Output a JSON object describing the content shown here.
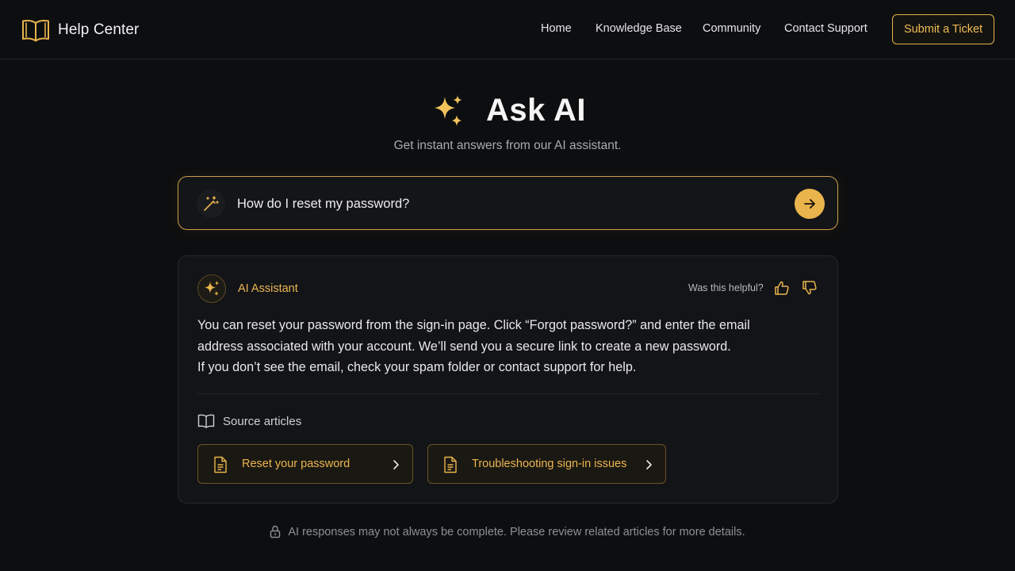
{
  "header": {
    "brand_title": "Help Center",
    "nav": [
      "Home",
      "Knowledge Base",
      "Community",
      "Contact Support"
    ],
    "cta_label": "Submit a Ticket"
  },
  "hero": {
    "title": "Ask AI",
    "subtitle": "Get instant answers from our AI assistant."
  },
  "search": {
    "value": "How do I reset my password?"
  },
  "answer": {
    "assistant_name": "AI Assistant",
    "helpful_label": "Was this helpful?",
    "lines": [
      "You can reset your password from the sign-in page. Click “Forgot password?” and enter the email",
      "address associated with your account. We’ll send you a secure link to create a new password.",
      "If you don’t see the email, check your spam folder or contact support for help."
    ],
    "sources_label": "Source articles",
    "sources": [
      "Reset your password",
      "Troubleshooting sign-in issues"
    ]
  },
  "footer": {
    "note": "AI responses may not always be complete. Please review related articles for more details."
  },
  "icons": {
    "brand": "open-book-icon",
    "hero": "sparkles-icon",
    "search": "magic-wand-icon",
    "send": "arrow-right-icon",
    "assistant": "sparkles-icon",
    "helpful_yes": "thumbs-up-icon",
    "helpful_no": "thumbs-down-icon",
    "sources": "open-book-icon",
    "article": "document-icon",
    "article_open": "chevron-right-icon",
    "footer": "lock-icon"
  },
  "colors": {
    "background": "#0d0e10",
    "accent": "#e9b44c",
    "card": "#131417",
    "text": "#e9e9eb",
    "muted": "#a9abb0"
  }
}
